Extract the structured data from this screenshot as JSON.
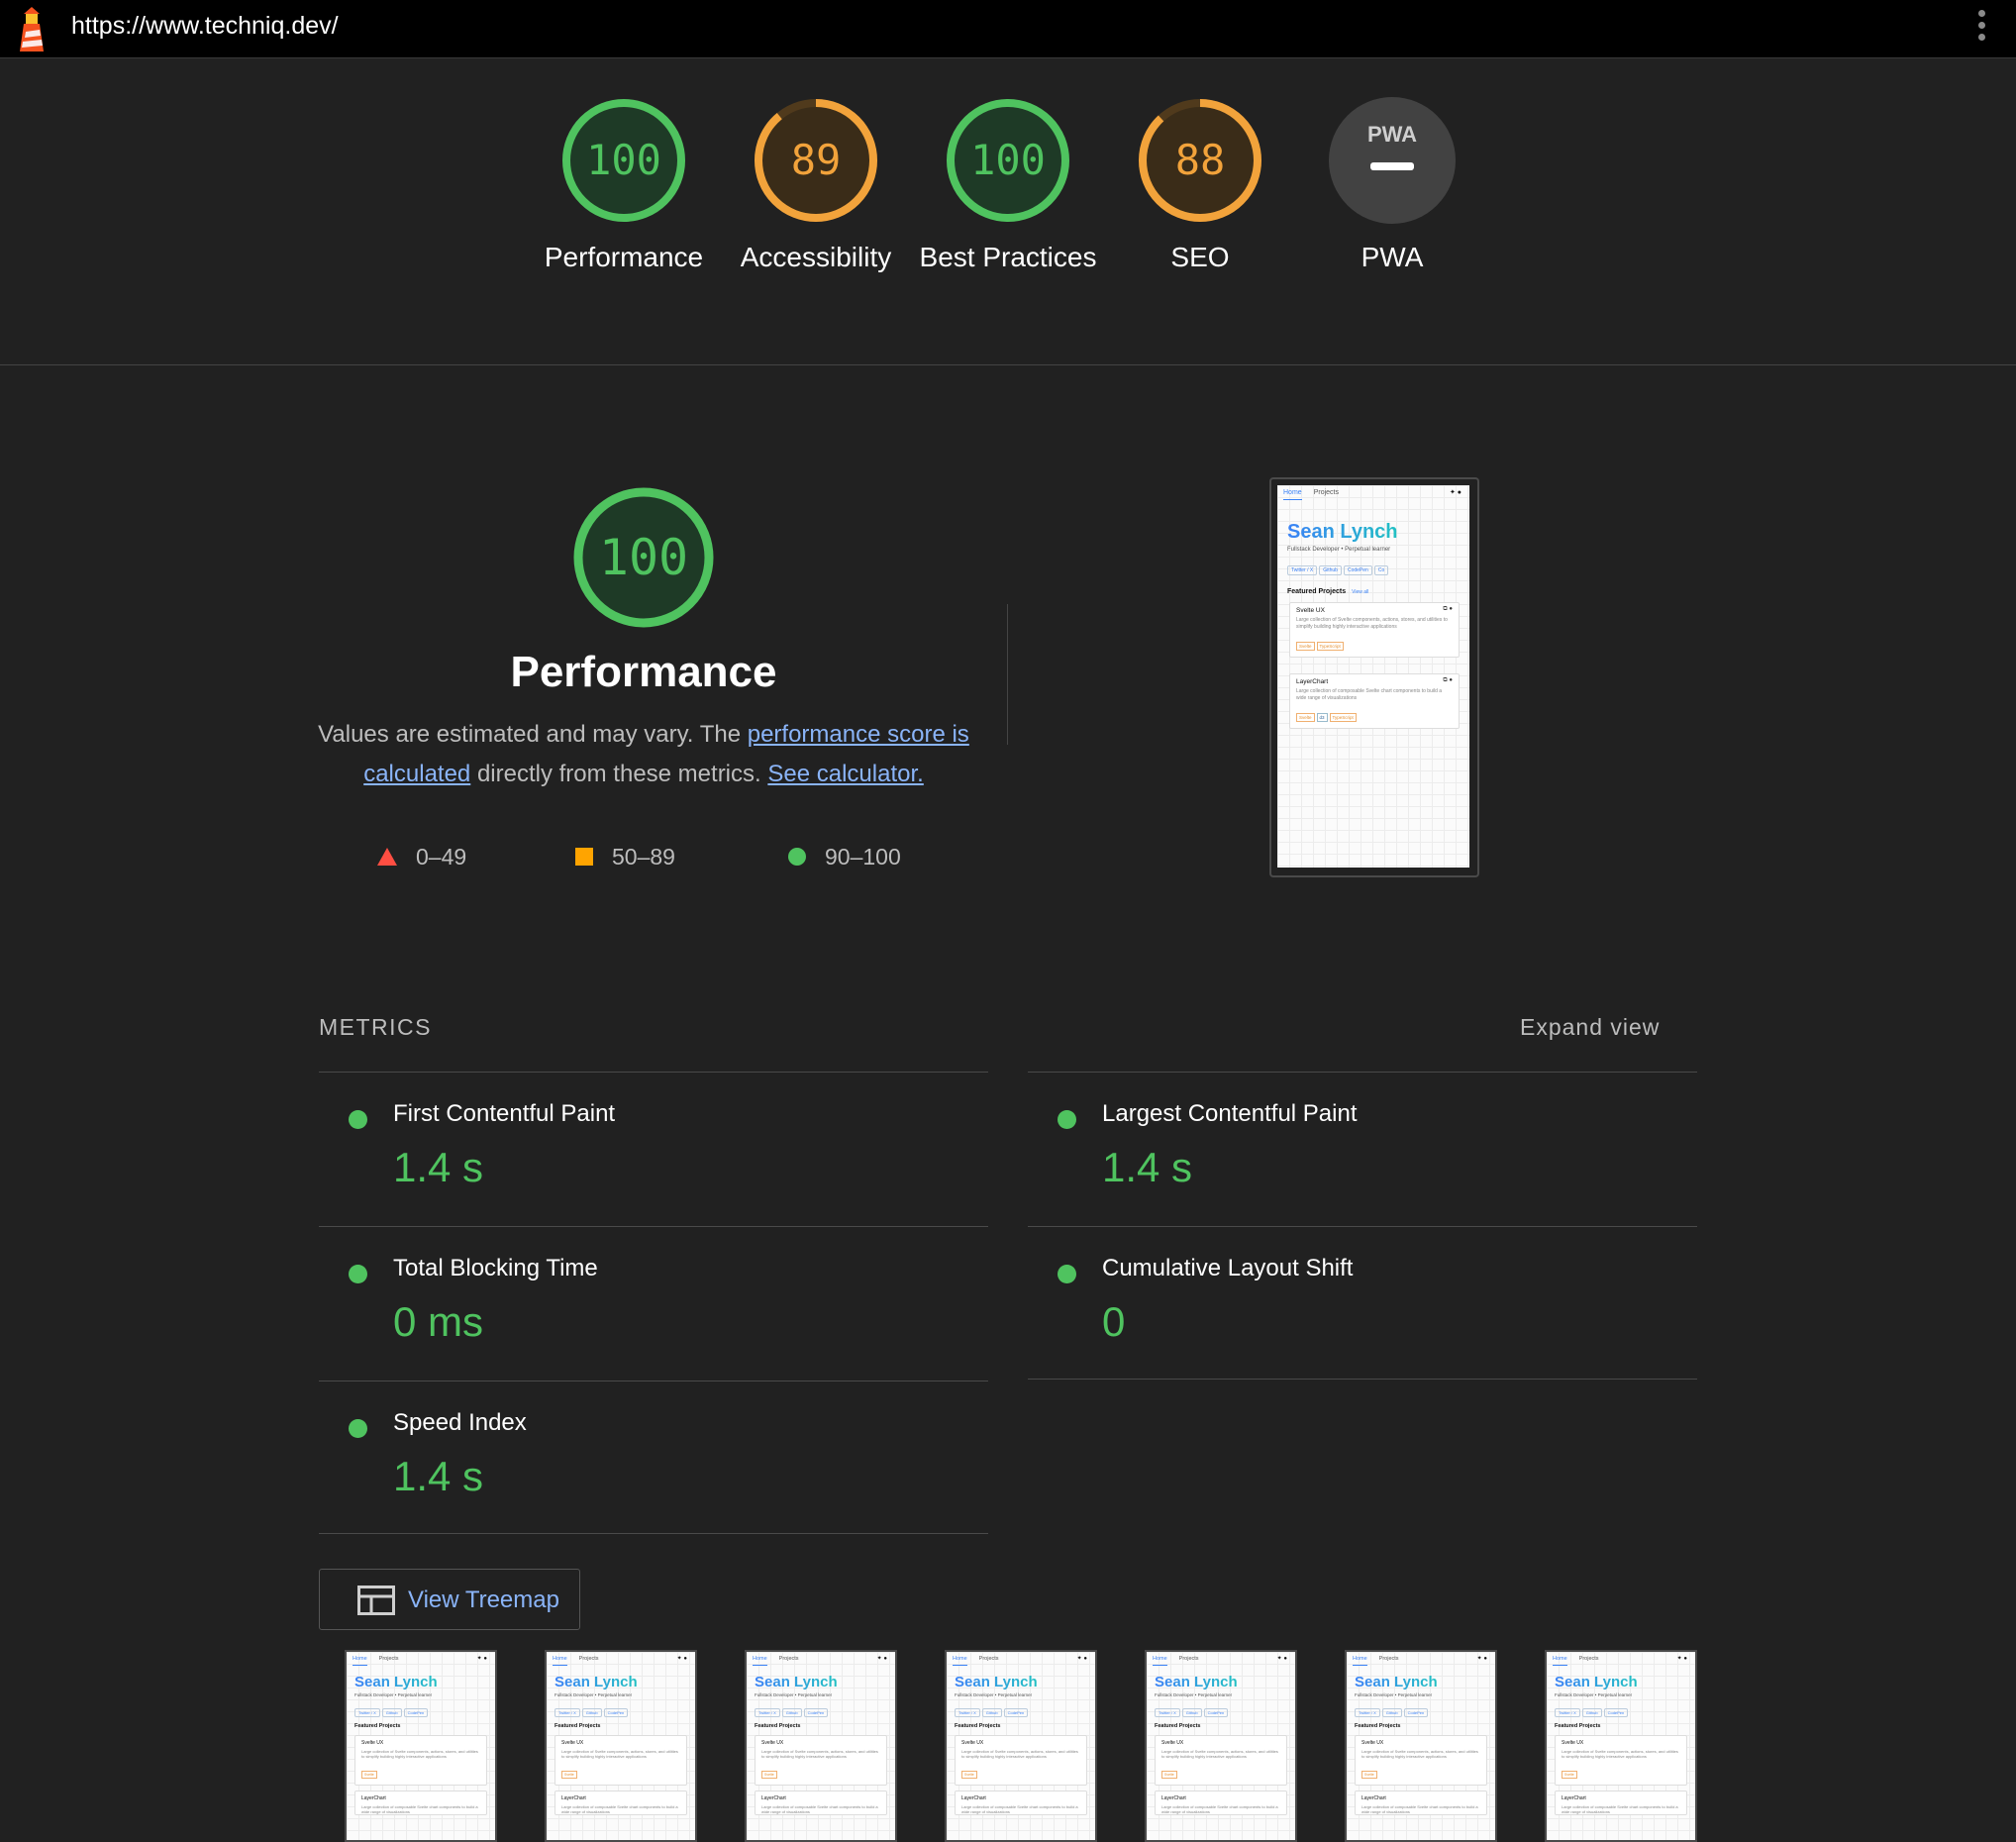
{
  "topbar": {
    "url": "https://www.techniq.dev/",
    "logo_icon": "lighthouse-icon",
    "menu_icon": "kebab-menu-icon"
  },
  "gauges": [
    {
      "label": "Performance",
      "score": 100,
      "color": "#0cce6b",
      "status": "pass"
    },
    {
      "label": "Accessibility",
      "score": 89,
      "color": "#ffa400",
      "status": "average"
    },
    {
      "label": "Best Practices",
      "score": 100,
      "color": "#0cce6b",
      "status": "pass"
    },
    {
      "label": "SEO",
      "score": 88,
      "color": "#ffa400",
      "status": "average"
    },
    {
      "label": "PWA",
      "score_text": "PWA",
      "dash": "—",
      "color": "#424242"
    }
  ],
  "performance": {
    "score": 100,
    "title": "Performance",
    "desc_prefix": "Values are estimated and may vary. The ",
    "desc_link1": "performance score is calculated",
    "desc_middle": " directly from these metrics. ",
    "desc_link2": "See calculator.",
    "legend": [
      {
        "range": "0–49",
        "shape": "triangle",
        "color": "#ff4e42"
      },
      {
        "range": "50–89",
        "shape": "square",
        "color": "#ffa400"
      },
      {
        "range": "90–100",
        "shape": "circle",
        "color": "#0cce6b"
      }
    ]
  },
  "screenshot": {
    "nav_home": "Home",
    "nav_projects": "Projects",
    "name": "Sean Lynch",
    "subtitle": "Fullstack Developer • Perpetual learner",
    "chips": [
      "Twitter / X",
      "Github",
      "CodePen",
      "Co"
    ],
    "featured": "Featured Projects",
    "view_all": "View all",
    "card1_title": "Svelte UX",
    "card1_desc": "Large collection of Svelte components, actions, stores, and utilities to simplify building highly interactive applications",
    "card1_tags": [
      "Svelte",
      "TypeScript"
    ],
    "card2_title": "LayerChart",
    "card2_desc": "Large collection of composable Svelte chart components to build a wide range of visualizations",
    "card2_tags": [
      "Svelte",
      "d3",
      "TypeScript"
    ]
  },
  "metrics": {
    "header": "METRICS",
    "expand": "Expand view",
    "items": [
      {
        "name": "First Contentful Paint",
        "value": "1.4 s"
      },
      {
        "name": "Largest Contentful Paint",
        "value": "1.4 s"
      },
      {
        "name": "Total Blocking Time",
        "value": "0 ms"
      },
      {
        "name": "Cumulative Layout Shift",
        "value": "0"
      },
      {
        "name": "Speed Index",
        "value": "1.4 s"
      }
    ]
  },
  "treemap": {
    "label": "View Treemap",
    "icon": "treemap-icon"
  },
  "filmstrip_count": 7
}
